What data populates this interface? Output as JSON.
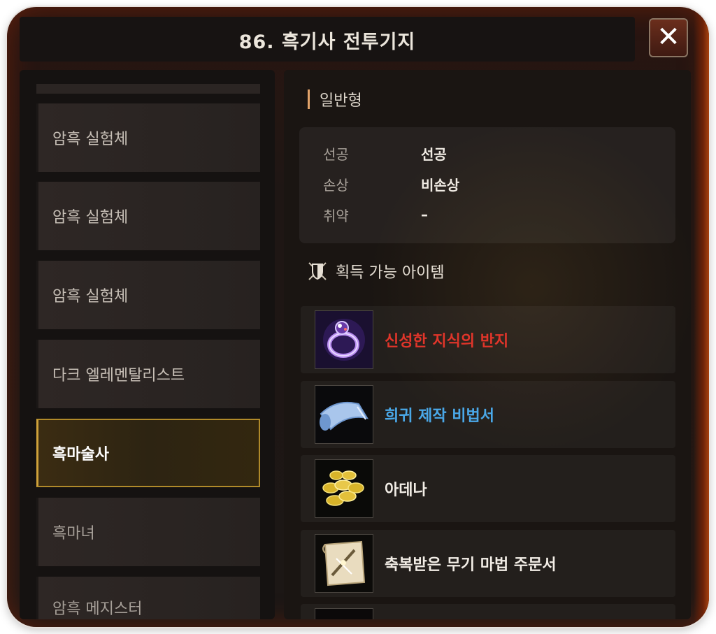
{
  "window": {
    "title": "86. 흑기사 전투기지",
    "close_label": "✕"
  },
  "monster_list": [
    {
      "name": "암흑 실험체",
      "selected": false
    },
    {
      "name": "암흑 실험체",
      "selected": false
    },
    {
      "name": "암흑 실험체",
      "selected": false
    },
    {
      "name": "다크 엘레멘탈리스트",
      "selected": false
    },
    {
      "name": "흑마술사",
      "selected": true
    },
    {
      "name": "흑마녀",
      "selected": false
    },
    {
      "name": "암흑 메지스터",
      "selected": false
    }
  ],
  "detail": {
    "type_label": "일반형",
    "attributes": [
      {
        "key": "선공",
        "value": "선공"
      },
      {
        "key": "손상",
        "value": "비손상"
      },
      {
        "key": "취약",
        "value": "–"
      }
    ],
    "items_heading": "획득 가능 아이템",
    "items": [
      {
        "name": "신성한 지식의 반지",
        "color": "#e0352a",
        "icon": "purple-ring-icon"
      },
      {
        "name": "희귀 제작 비법서",
        "color": "#4aa8e8",
        "icon": "blue-scroll-icon"
      },
      {
        "name": "아데나",
        "color": "#f2ede6",
        "icon": "gold-coins-icon"
      },
      {
        "name": "축복받은 무기 마법 주문서",
        "color": "#f2ede6",
        "icon": "parchment-scroll-icon"
      }
    ]
  },
  "colors": {
    "selected_border": "#b08a2a",
    "accent_bar": "#e2a36a"
  }
}
